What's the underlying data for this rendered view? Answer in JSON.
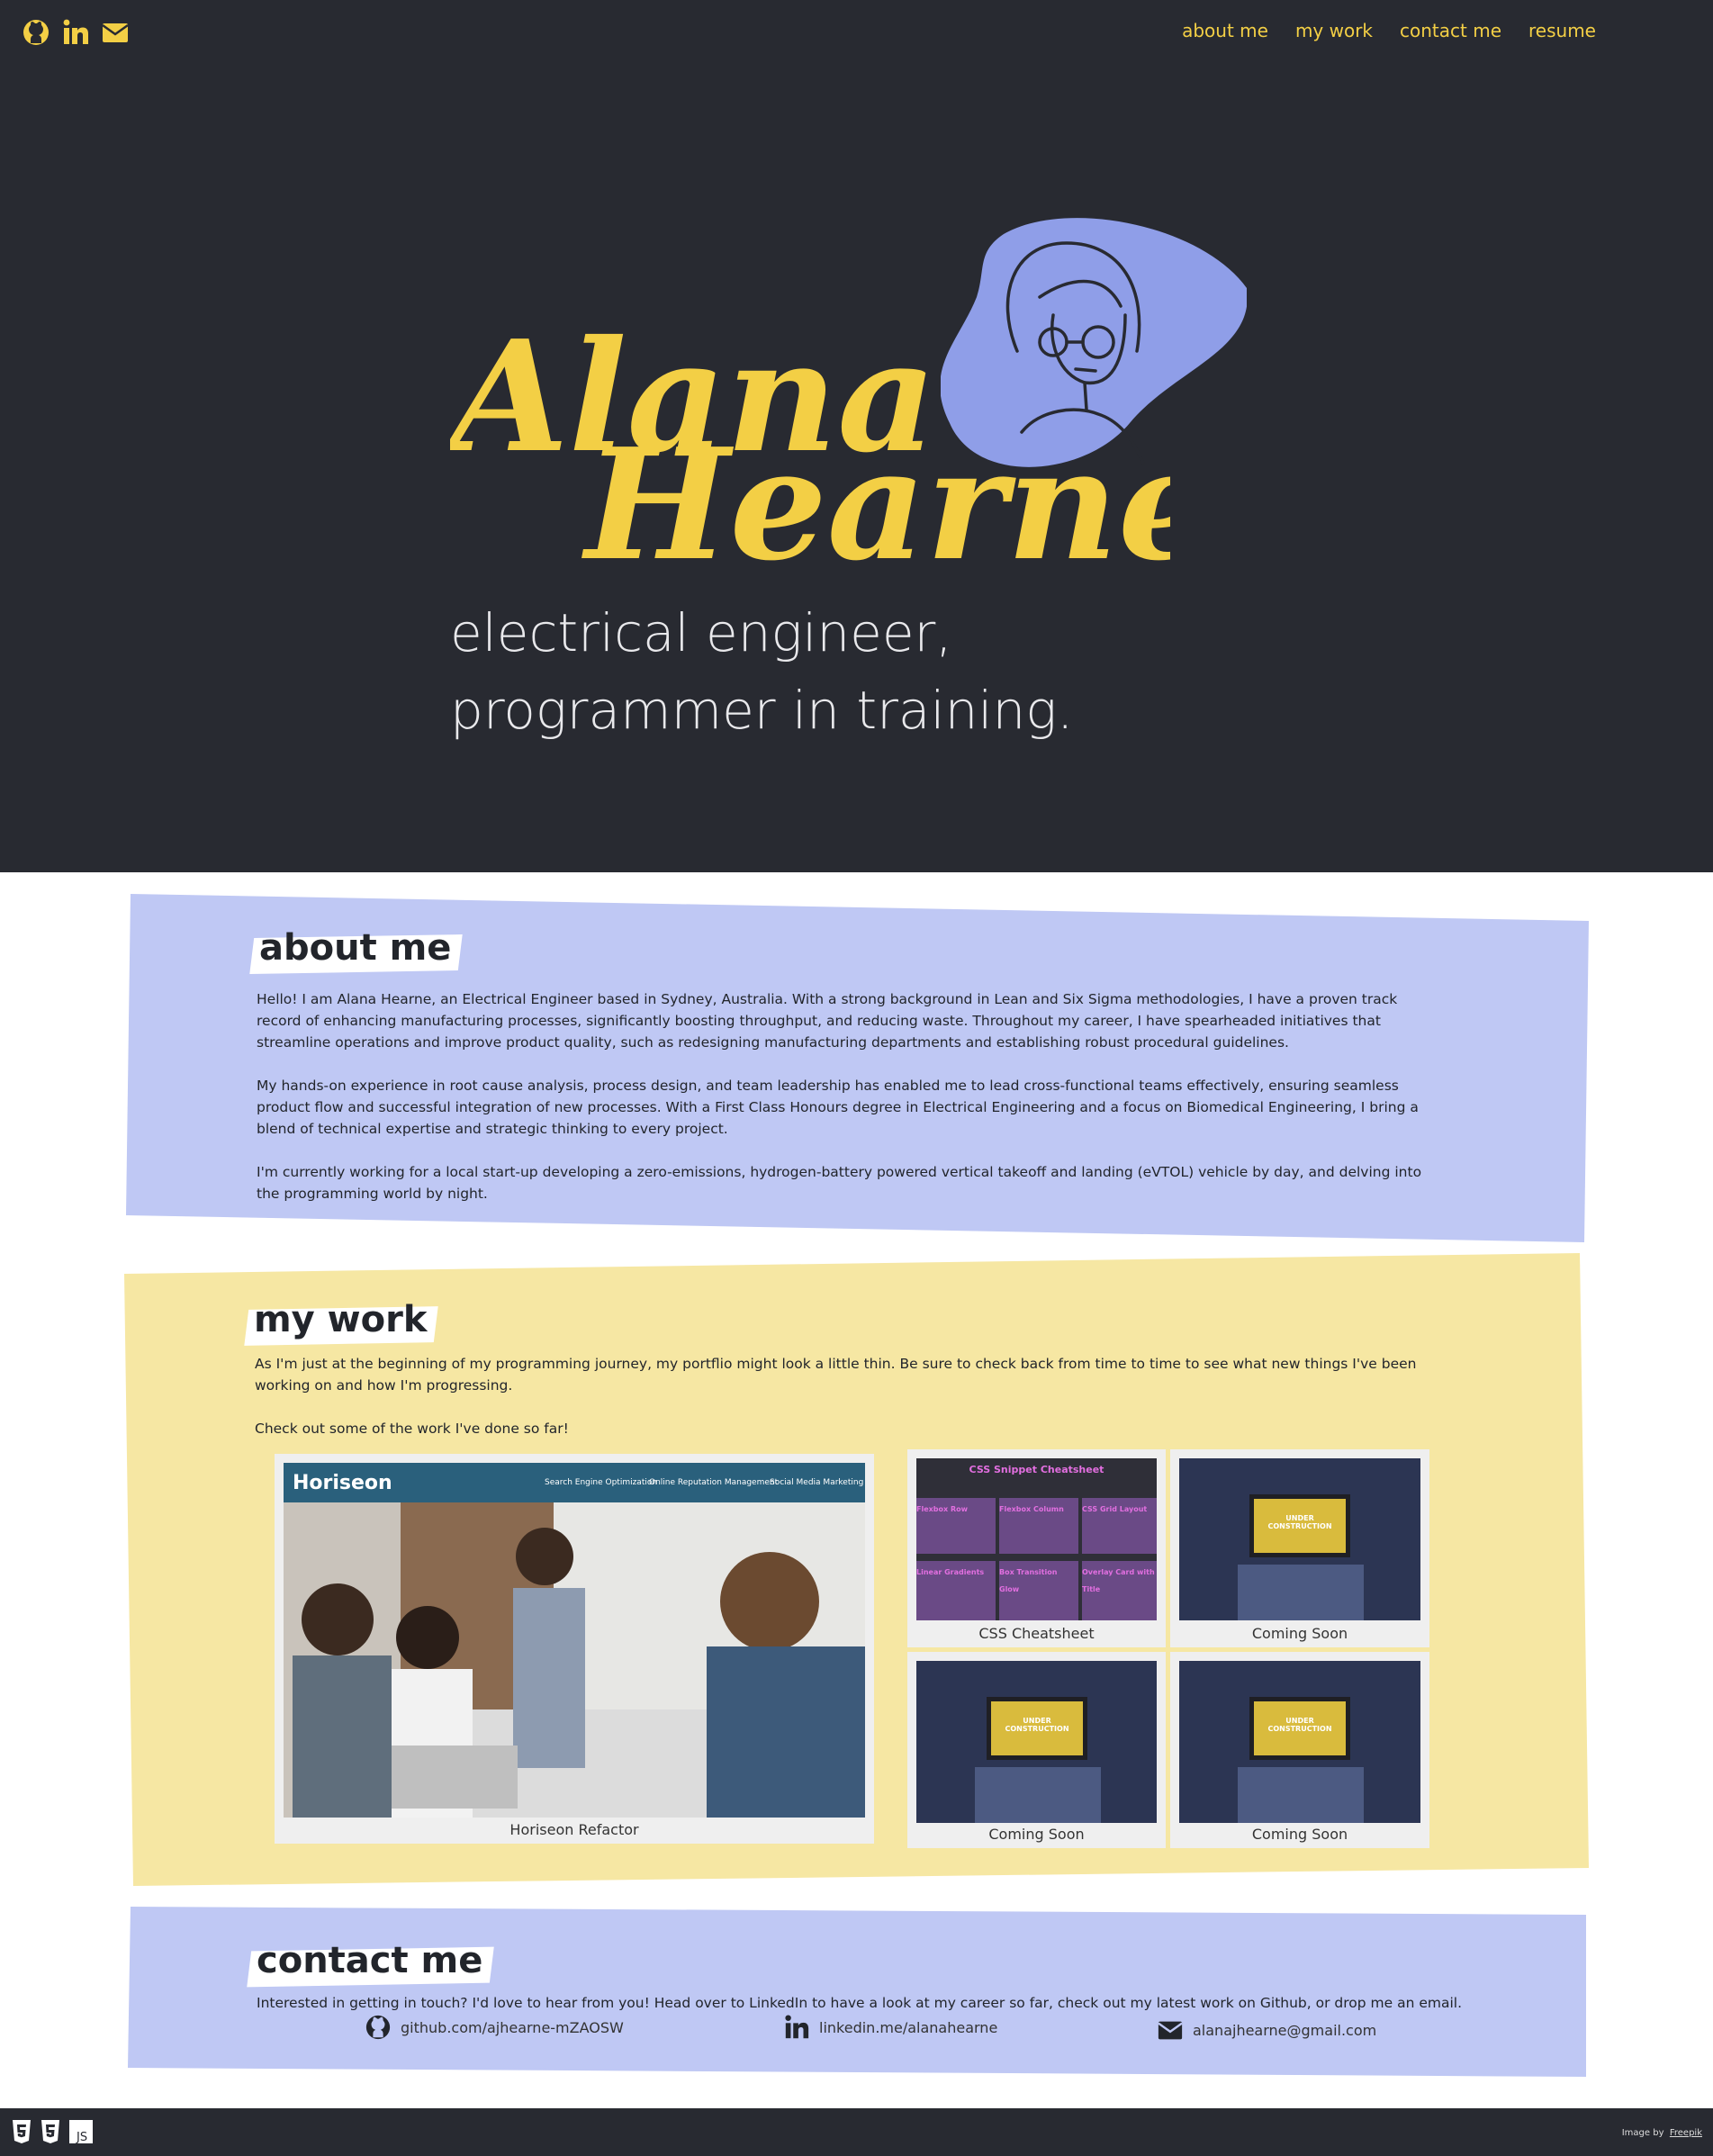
{
  "nav": {
    "items": [
      "about me",
      "my work",
      "contact me",
      "resume"
    ]
  },
  "social_icons": [
    "github-icon",
    "linkedin-icon",
    "envelope-icon"
  ],
  "hero": {
    "name_line1": "Alana",
    "name_line2": "Hearne",
    "tagline_line1": "electrical engineer,",
    "tagline_line2": "programmer in training."
  },
  "about": {
    "heading": "about me",
    "p1": "Hello! I am Alana Hearne, an Electrical Engineer based in Sydney, Australia. With a strong background in Lean and Six Sigma methodologies, I have a proven track record of enhancing manufacturing processes, significantly boosting throughput, and reducing waste. Throughout my career, I have spearheaded initiatives that streamline operations and improve product quality, such as redesigning manufacturing departments and establishing robust procedural guidelines.",
    "p2": "My hands-on experience in root cause analysis, process design, and team leadership has enabled me to lead cross-functional teams effectively, ensuring seamless product flow and successful integration of new processes. With a First Class Honours degree in Electrical Engineering and a focus on Biomedical Engineering, I bring a blend of technical expertise and strategic thinking to every project.",
    "p3": "I'm currently working for a local start-up developing a zero-emissions, hydrogen-battery powered vertical takeoff and landing (eVTOL) vehicle by day, and delving into the programming world by night."
  },
  "work": {
    "heading": "my work",
    "p1": "As I'm just at the beginning of my programming journey, my portflio might look a little thin. Be sure to check back from time to time to see what new things I've been working on and how I'm progressing.",
    "p2": "Check out some of the work I've done so far!",
    "horiseon": {
      "brand": "Horiseon",
      "nav": [
        "Search Engine Optimization",
        "Online Reputation Management",
        "Social Media Marketing"
      ],
      "caption": "Horiseon Refactor"
    },
    "cheatsheet": {
      "title": "CSS Snippet Cheatsheet",
      "cells": [
        "Flexbox Row",
        "Flexbox Column",
        "CSS Grid Layout",
        "Linear Gradients",
        "Box Transition Glow",
        "Overlay Card with Title"
      ],
      "caption": "CSS Cheatsheet"
    },
    "coming_soon": {
      "screen_text": "UNDER CONSTRUCTION",
      "caption": "Coming Soon"
    }
  },
  "contact": {
    "heading": "contact me",
    "intro": "Interested in getting in touch? I'd love to hear from you! Head over to LinkedIn to have a look at my career so far, check out my latest work on Github, or drop me an email.",
    "github": "github.com/ajhearne-mZAOSW",
    "linkedin": "linkedin.me/alanahearne",
    "email": "alanajhearne@gmail.com"
  },
  "footer": {
    "tech_icons": [
      "html5-icon",
      "css3-icon",
      "javascript-icon"
    ],
    "credit_prefix": "Image by",
    "credit_link": "Freepik"
  },
  "colors": {
    "dark": "#282a31",
    "accent": "#f3cf45",
    "lavender": "#bfc8f4",
    "butter": "#f6e7a3",
    "blob": "#8f9ee8"
  }
}
